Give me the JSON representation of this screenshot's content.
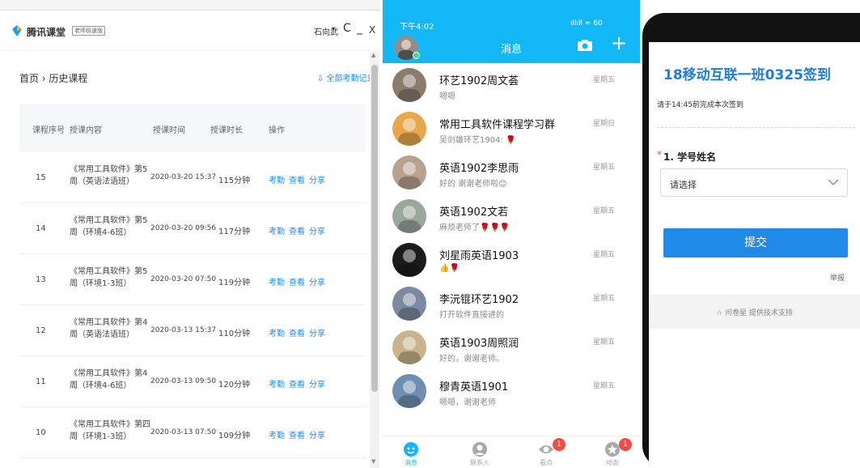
{
  "tencent": {
    "app_name": "腾讯课堂",
    "badge": "老师极速版",
    "user": "石向武",
    "caret": "▾",
    "refresh": "C",
    "minimize": "_",
    "close": "X",
    "breadcrumb": "首页 › 历史课程",
    "download": "⇩ 全部考勤记录",
    "headers": [
      "课程序号",
      "授课内容",
      "授课时间",
      "授课时长",
      "操作"
    ],
    "rows": [
      {
        "no": "15",
        "content": "《常用工具软件》第5周（英语法语班）",
        "time": "2020-03-20 15:37",
        "duration": "115分钟"
      },
      {
        "no": "14",
        "content": "《常用工具软件》第5周（环境4-6班）",
        "time": "2020-03-20 09:56",
        "duration": "117分钟"
      },
      {
        "no": "13",
        "content": "《常用工具软件》第5周（环境1-3班）",
        "time": "2020-03-20 07:50",
        "duration": "119分钟"
      },
      {
        "no": "12",
        "content": "《常用工具软件》第4周（英语法语班）",
        "time": "2020-03-13 15:37",
        "duration": "110分钟"
      },
      {
        "no": "11",
        "content": "《常用工具软件》第4周（环境4-6班）",
        "time": "2020-03-13 09:50",
        "duration": "120分钟"
      },
      {
        "no": "10",
        "content": "《常用工具软件》第四周（环境1-3班）",
        "time": "2020-03-13 07:50",
        "duration": "109分钟"
      }
    ],
    "actions": [
      "考勤",
      "查看",
      "分享"
    ],
    "scroll_up": "▲",
    "scroll_down": "▼"
  },
  "qq": {
    "time": "下午4:02",
    "status": "ıllıll ≈ 60",
    "title": "消息",
    "plus": "+",
    "chats": [
      {
        "name": "环艺1902周文荟",
        "preview": "嗯嗯",
        "day": "星期五",
        "avatar_color": "#8a7d6e"
      },
      {
        "name": "常用工具软件课程学习群",
        "preview": "吴剑雄环艺1904: 🌹",
        "day": "星期日",
        "avatar_color": "#e8a74b"
      },
      {
        "name": "英语1902李思雨",
        "preview": "好的 谢谢老师啦😊",
        "day": "星期五",
        "avatar_color": "#b9a18f"
      },
      {
        "name": "英语1902文若",
        "preview": "麻烦老师了🌹🌹🌹",
        "day": "星期五",
        "avatar_color": "#9aa79c"
      },
      {
        "name": "刘星雨英语1903",
        "preview": "👍🌹",
        "day": "星期五",
        "avatar_color": "#1b1b1b"
      },
      {
        "name": "李沅锟环艺1902",
        "preview": "打开软件直接进的",
        "day": "星期五",
        "avatar_color": "#7c8aa0"
      },
      {
        "name": "英语1903周照润",
        "preview": "好的，谢谢老师。",
        "day": "星期五",
        "avatar_color": "#c9b48c"
      },
      {
        "name": "穆青英语1901",
        "preview": "嗯嗯，谢谢老师",
        "day": "星期五",
        "avatar_color": "#6f8fb0"
      }
    ],
    "tabs": [
      {
        "label": "消息",
        "badge": ""
      },
      {
        "label": "联系人",
        "badge": ""
      },
      {
        "label": "看点",
        "badge": "1"
      },
      {
        "label": "动态",
        "badge": "1"
      }
    ],
    "colors": {
      "header": "#12b7f5",
      "badge": "#f34b3f"
    }
  },
  "survey": {
    "title": "18移动互联一班0325签到",
    "note": "请于14:45前完成本次签到",
    "star": "*",
    "question": "1. 学号姓名",
    "select_placeholder": "请选择",
    "submit": "提交",
    "report": "举报",
    "footer": "☆ 问卷星 提供技术支持",
    "accent": "#1f8ae8"
  }
}
